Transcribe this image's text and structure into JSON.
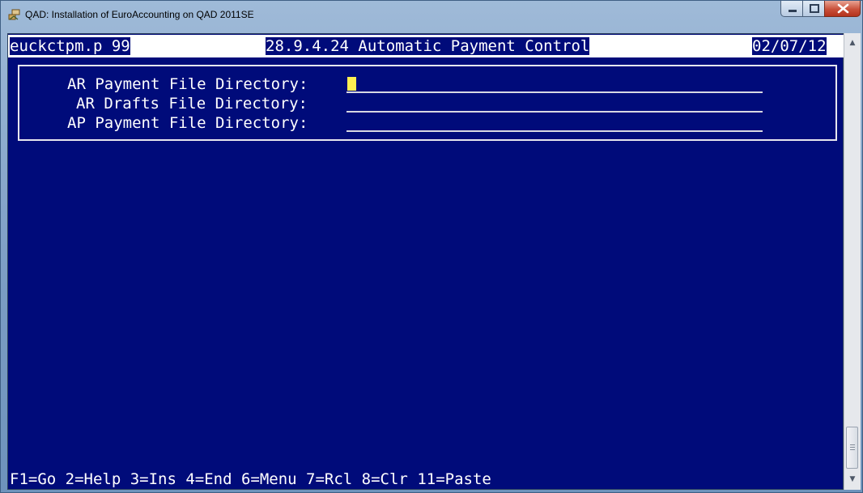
{
  "window": {
    "title": "QAD: Installation of EuroAccounting on QAD 2011SE",
    "icons": {
      "app": "qad-app-icon",
      "minimize": "minimize-icon",
      "maximize": "maximize-icon",
      "close": "close-icon"
    }
  },
  "header": {
    "program": "euckctpm.p 99",
    "menu_title": "28.9.4.24 Automatic Payment Control",
    "date": "02/07/12"
  },
  "form": {
    "fields": [
      {
        "label": "AR Payment File Directory:",
        "value": ""
      },
      {
        "label": "AR Drafts File Directory:",
        "value": ""
      },
      {
        "label": "AP Payment File Directory:",
        "value": ""
      }
    ]
  },
  "footer": {
    "keys": "F1=Go 2=Help 3=Ins 4=End 6=Menu 7=Rcl 8=Clr 11=Paste"
  },
  "colors": {
    "console_bg": "#000b7a",
    "cursor": "#ffef52",
    "title_bar": "#9fbad8",
    "close_button": "#c9503a"
  }
}
